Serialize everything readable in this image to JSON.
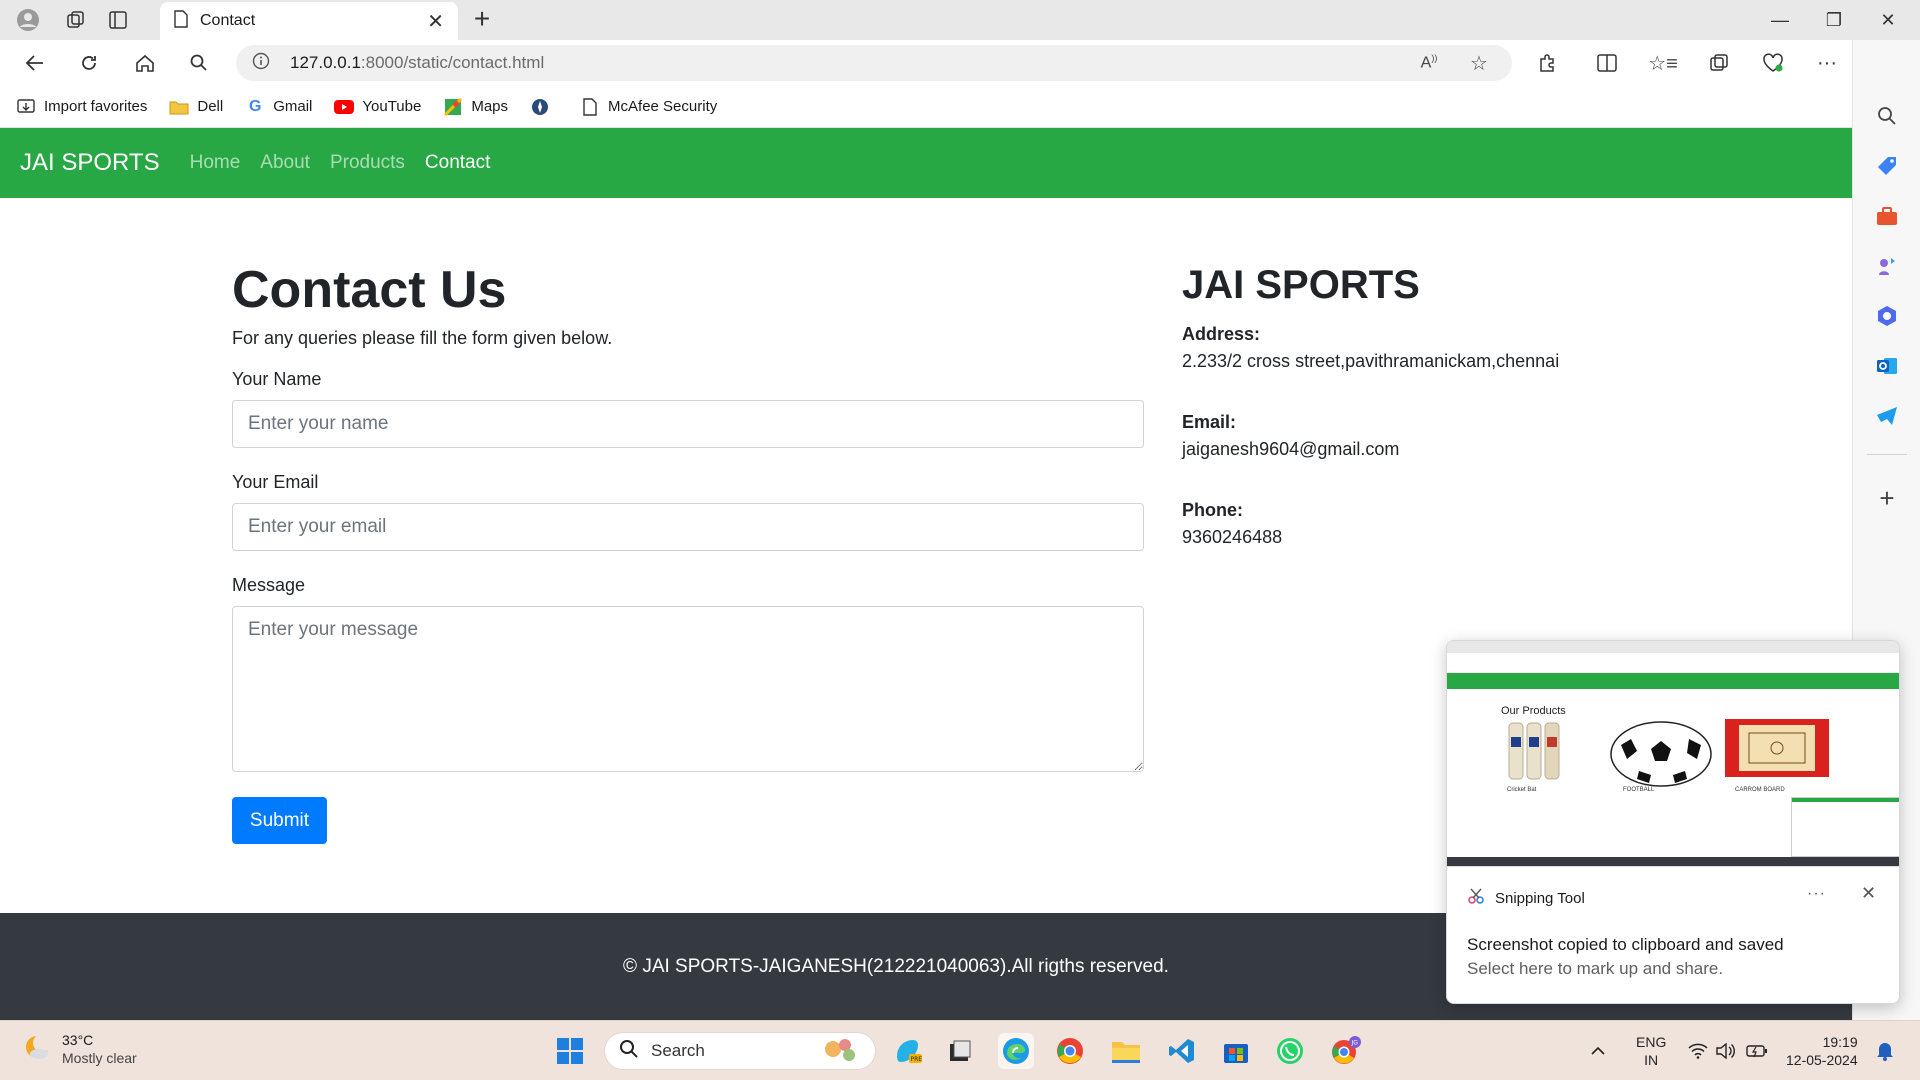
{
  "browser": {
    "tab_title": "Contact",
    "url_host": "127.0.0.1",
    "url_rest": ":8000/static/contact.html",
    "favorites": [
      {
        "label": "Import favorites",
        "icon": "import-icon"
      },
      {
        "label": "Dell",
        "icon": "folder-icon"
      },
      {
        "label": "Gmail",
        "icon": "google-icon"
      },
      {
        "label": "YouTube",
        "icon": "youtube-icon"
      },
      {
        "label": "Maps",
        "icon": "maps-icon"
      },
      {
        "label": "",
        "icon": "compass-icon"
      },
      {
        "label": "McAfee Security",
        "icon": "page-icon"
      }
    ]
  },
  "site": {
    "brand": "JAI SPORTS",
    "nav": [
      "Home",
      "About",
      "Products",
      "Contact"
    ],
    "active_nav": "Contact",
    "accent": "#28a745"
  },
  "form": {
    "title": "Contact Us",
    "subtitle": "For any queries please fill the form given below.",
    "name_label": "Your Name",
    "name_placeholder": "Enter your name",
    "email_label": "Your Email",
    "email_placeholder": "Enter your email",
    "message_label": "Message",
    "message_placeholder": "Enter your message",
    "submit_label": "Submit"
  },
  "info": {
    "title": "JAI SPORTS",
    "address_label": "Address:",
    "address_value": "2.233/2 cross street,pavithramanickam,chennai",
    "email_label": "Email:",
    "email_value": "jaiganesh9604@gmail.com",
    "phone_label": "Phone:",
    "phone_value": "9360246488"
  },
  "footer": {
    "text": "© JAI SPORTS-JAIGANESH(212221040063).All rigths reserved."
  },
  "toast": {
    "app_name": "Snipping Tool",
    "line1": "Screenshot copied to clipboard and saved",
    "line2": "Select here to mark up and share.",
    "thumb_title": "Our Products",
    "thumb_captions": [
      "Cricket Bat",
      "FOOTBALL",
      "CARROM BOARD"
    ]
  },
  "taskbar": {
    "temperature": "33°C",
    "condition": "Mostly clear",
    "search_label": "Search",
    "lang_line1": "ENG",
    "lang_line2": "IN",
    "time": "19:19",
    "date": "12-05-2024"
  }
}
